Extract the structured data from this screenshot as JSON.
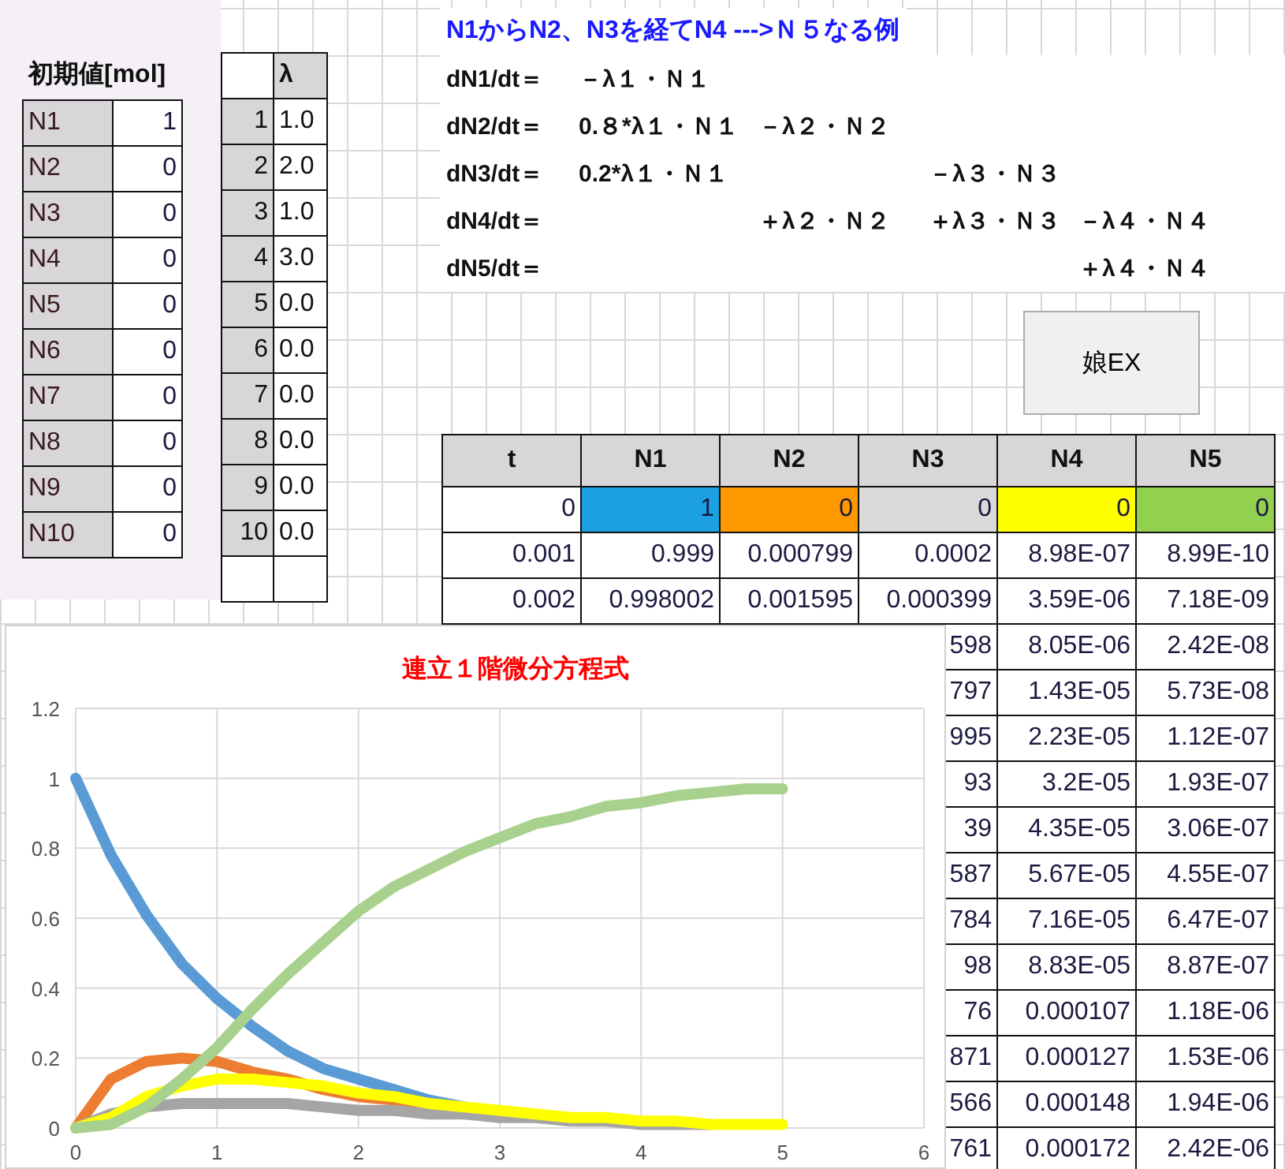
{
  "initial_values": {
    "title": "初期値[mol]",
    "rows": [
      {
        "label": "N1",
        "value": "1"
      },
      {
        "label": "N2",
        "value": "0"
      },
      {
        "label": "N3",
        "value": "0"
      },
      {
        "label": "N4",
        "value": "0"
      },
      {
        "label": "N5",
        "value": "0"
      },
      {
        "label": "N6",
        "value": "0"
      },
      {
        "label": "N7",
        "value": "0"
      },
      {
        "label": "N8",
        "value": "0"
      },
      {
        "label": "N9",
        "value": "0"
      },
      {
        "label": "N10",
        "value": "0"
      }
    ]
  },
  "lambda_table": {
    "header": "λ",
    "rows": [
      {
        "index": "1",
        "value": "1.0"
      },
      {
        "index": "2",
        "value": "2.0"
      },
      {
        "index": "3",
        "value": "1.0"
      },
      {
        "index": "4",
        "value": "3.0"
      },
      {
        "index": "5",
        "value": "0.0"
      },
      {
        "index": "6",
        "value": "0.0"
      },
      {
        "index": "7",
        "value": "0.0"
      },
      {
        "index": "8",
        "value": "0.0"
      },
      {
        "index": "9",
        "value": "0.0"
      },
      {
        "index": "10",
        "value": "0.0"
      }
    ]
  },
  "formulas": {
    "title": "N1からN2、N3を経てN4 --->Ｎ５なる例",
    "lines": [
      {
        "lhs": "dN1/dt＝",
        "n1_term": "－λ１・Ｎ１"
      },
      {
        "lhs": "dN2/dt＝",
        "n1_term": "0.８*λ１・Ｎ１",
        "n2_term": "－λ２・Ｎ２"
      },
      {
        "lhs": "dN3/dt＝",
        "n1_term": "0.2*λ１・Ｎ１",
        "n3_term": "－λ３・Ｎ３"
      },
      {
        "lhs": "dN4/dt＝",
        "n2_term": "＋λ２・Ｎ２",
        "n3_term": "＋λ３・Ｎ３",
        "n4_term": "－λ４・Ｎ４"
      },
      {
        "lhs": "dN5/dt＝",
        "n4_term": "＋λ４・Ｎ４"
      }
    ]
  },
  "daughter_button": {
    "label": "娘EX"
  },
  "data_table": {
    "columns": [
      "t",
      "N1",
      "N2",
      "N3",
      "N4",
      "N5"
    ],
    "rows": [
      {
        "cells": [
          {
            "text": "0"
          },
          {
            "text": "1",
            "color": "#1ba1e2"
          },
          {
            "text": "0",
            "color": "#ff9900"
          },
          {
            "text": "0",
            "color": "#d9d9d9"
          },
          {
            "text": "0",
            "color": "#ffff00"
          },
          {
            "text": "0",
            "color": "#92d050"
          }
        ]
      },
      {
        "cells": [
          {
            "text": "0.001"
          },
          {
            "text": "0.999"
          },
          {
            "text": "0.000799"
          },
          {
            "text": "0.0002"
          },
          {
            "text": "8.98E-07"
          },
          {
            "text": "8.99E-10"
          }
        ]
      },
      {
        "cells": [
          {
            "text": "0.002"
          },
          {
            "text": "0.998002"
          },
          {
            "text": "0.001595"
          },
          {
            "text": "0.000399"
          },
          {
            "text": "3.59E-06"
          },
          {
            "text": "7.18E-09"
          }
        ]
      },
      {
        "cells": [
          {
            "text": "598"
          },
          {
            "text": "8.05E-06"
          },
          {
            "text": "2.42E-08"
          }
        ]
      },
      {
        "cells": [
          {
            "text": "797"
          },
          {
            "text": "1.43E-05"
          },
          {
            "text": "5.73E-08"
          }
        ]
      },
      {
        "cells": [
          {
            "text": "995"
          },
          {
            "text": "2.23E-05"
          },
          {
            "text": "1.12E-07"
          }
        ]
      },
      {
        "cells": [
          {
            "text": "93"
          },
          {
            "text": "3.2E-05"
          },
          {
            "text": "1.93E-07"
          }
        ]
      },
      {
        "cells": [
          {
            "text": "39"
          },
          {
            "text": "4.35E-05"
          },
          {
            "text": "3.06E-07"
          }
        ]
      },
      {
        "cells": [
          {
            "text": "587"
          },
          {
            "text": "5.67E-05"
          },
          {
            "text": "4.55E-07"
          }
        ]
      },
      {
        "cells": [
          {
            "text": "784"
          },
          {
            "text": "7.16E-05"
          },
          {
            "text": "6.47E-07"
          }
        ]
      },
      {
        "cells": [
          {
            "text": "98"
          },
          {
            "text": "8.83E-05"
          },
          {
            "text": "8.87E-07"
          }
        ]
      },
      {
        "cells": [
          {
            "text": "76"
          },
          {
            "text": "0.000107"
          },
          {
            "text": "1.18E-06"
          }
        ]
      },
      {
        "cells": [
          {
            "text": "871"
          },
          {
            "text": "0.000127"
          },
          {
            "text": "1.53E-06"
          }
        ]
      },
      {
        "cells": [
          {
            "text": "566"
          },
          {
            "text": "0.000148"
          },
          {
            "text": "1.94E-06"
          }
        ]
      },
      {
        "cells": [
          {
            "text": "761"
          },
          {
            "text": "0.000172"
          },
          {
            "text": "2.42E-06"
          }
        ]
      }
    ]
  },
  "chart": {
    "chart_data": {
      "type": "line",
      "title": "連立１階微分方程式",
      "x": [
        0,
        0.25,
        0.5,
        0.75,
        1,
        1.25,
        1.5,
        1.75,
        2,
        2.25,
        2.5,
        2.75,
        3,
        3.25,
        3.5,
        3.75,
        4,
        4.25,
        4.5,
        4.75,
        5
      ],
      "series": [
        {
          "color": "#5b9bd5",
          "values": [
            1,
            0.78,
            0.61,
            0.47,
            0.37,
            0.29,
            0.22,
            0.17,
            0.14,
            0.11,
            0.08,
            0.06,
            null,
            null,
            null,
            null,
            null,
            null,
            null,
            null,
            null
          ]
        },
        {
          "color": "#ed7d31",
          "values": [
            0,
            0.14,
            0.19,
            0.2,
            0.19,
            0.16,
            0.14,
            0.11,
            0.09,
            0.08,
            0.06,
            null,
            null,
            null,
            null,
            null,
            null,
            null,
            null,
            null,
            null
          ]
        },
        {
          "color": "#a5a5a5",
          "values": [
            0,
            0.04,
            0.06,
            0.07,
            0.07,
            0.07,
            0.07,
            0.06,
            0.05,
            0.05,
            0.04,
            0.04,
            0.03,
            0.03,
            0.02,
            0.02,
            0.01,
            0.01,
            0.01,
            null,
            null
          ]
        },
        {
          "color": "#ffff00",
          "values": [
            0,
            0.03,
            0.09,
            0.12,
            0.14,
            0.14,
            0.13,
            0.12,
            0.1,
            0.09,
            0.07,
            0.06,
            0.05,
            0.04,
            0.03,
            0.03,
            0.02,
            0.02,
            0.01,
            0.01,
            0.01
          ]
        },
        {
          "color": "#a9d18e",
          "values": [
            0,
            0.01,
            0.06,
            0.14,
            0.23,
            0.34,
            0.44,
            0.53,
            0.62,
            0.69,
            0.74,
            0.79,
            0.83,
            0.87,
            0.89,
            0.92,
            0.93,
            0.95,
            0.96,
            0.97,
            0.97
          ]
        }
      ],
      "grid": true,
      "xlim": [
        0,
        6
      ],
      "ylim": [
        0,
        1.2
      ],
      "xticks": [
        0,
        1,
        2,
        3,
        4,
        5,
        6
      ],
      "yticks": [
        0,
        0.2,
        0.4,
        0.6,
        0.8,
        1,
        1.2
      ]
    }
  }
}
